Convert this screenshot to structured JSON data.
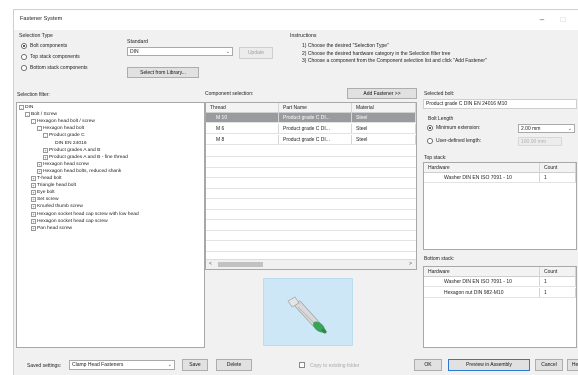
{
  "window": {
    "title": "Fastener System"
  },
  "selection_type": {
    "label": "Selection Type",
    "options": [
      "Bolt components",
      "Top stack components",
      "Bottom stack components"
    ],
    "selected": 0
  },
  "standard": {
    "label": "Standard",
    "value": "DIN",
    "update_label": "Update",
    "library_label": "Select from Library..."
  },
  "instructions": {
    "label": "Instructions",
    "lines": [
      "1) Choose the desired \"Selection Type\"",
      "2) Choose the desired hardware category in the Selection filter tree",
      "3) Choose a component from the Component selection list and click \"Add Fastener\""
    ]
  },
  "selection_filter": {
    "label": "Selection filter:",
    "items": [
      {
        "text": "DIN",
        "level": 0,
        "expander": "-"
      },
      {
        "text": "Bolt / Screw",
        "level": 1,
        "expander": "-"
      },
      {
        "text": "Hexagon head bolt / screw",
        "level": 2,
        "expander": "-"
      },
      {
        "text": "Hexagon head bolt",
        "level": 3,
        "expander": "-"
      },
      {
        "text": "Product grade C",
        "level": 4,
        "expander": "-"
      },
      {
        "text": "DIN EN 24016",
        "level": 6,
        "expander": ""
      },
      {
        "text": "Product grades A and B",
        "level": 4,
        "expander": "+"
      },
      {
        "text": "Product grades A and B - fine thread",
        "level": 4,
        "expander": "+"
      },
      {
        "text": "Hexagon head screw",
        "level": 3,
        "expander": "+"
      },
      {
        "text": "Hexagon head bolts, reduced shank",
        "level": 3,
        "expander": "+"
      },
      {
        "text": "T-head bolt",
        "level": 2,
        "expander": "+"
      },
      {
        "text": "Triangle head bolt",
        "level": 2,
        "expander": "+"
      },
      {
        "text": "Eye bolt",
        "level": 2,
        "expander": "+"
      },
      {
        "text": "Set screw",
        "level": 2,
        "expander": "+"
      },
      {
        "text": "Knurled thumb screw",
        "level": 2,
        "expander": "+"
      },
      {
        "text": "Hexagon socket head cap screw with low head",
        "level": 2,
        "expander": "+"
      },
      {
        "text": "Hexagon socket head cap screw",
        "level": 2,
        "expander": "+"
      },
      {
        "text": "Pan head screw",
        "level": 2,
        "expander": "+"
      }
    ]
  },
  "component_selection": {
    "label": "Component selection:",
    "add_label": "Add Fastener >>",
    "columns": [
      "Thread",
      "Part Name",
      "Material"
    ],
    "rows": [
      [
        "M 10",
        "Product grade C DI...",
        "Steel"
      ],
      [
        "M 6",
        "Product grade C DI...",
        "Steel"
      ],
      [
        "M 8",
        "Product grade C DI...",
        "Steel"
      ]
    ],
    "selected_row": 0
  },
  "selected_bolt": {
    "label": "Selected bolt:",
    "value": "Product grade C DIN EN 24016 M10",
    "bolt_length_label": "Bolt Length",
    "minimum_extension_label": "Minimum extension:",
    "minimum_extension_value": "2.00 mm",
    "user_defined_label": "User-defined length:",
    "user_defined_value": "100.00 mm"
  },
  "top_stack": {
    "label": "Top stack:",
    "columns": [
      "Hardware",
      "Count"
    ],
    "rows": [
      [
        "Washer DIN EN ISO 7091 - 10",
        "1"
      ]
    ]
  },
  "bottom_stack": {
    "label": "Bottom stack:",
    "columns": [
      "Hardware",
      "Count"
    ],
    "rows": [
      [
        "Washer DIN EN ISO 7091 - 10",
        "1"
      ],
      [
        "Hexagon nut DIN 982-M10",
        "1"
      ]
    ]
  },
  "footer": {
    "saved_settings_label": "Saved settings:",
    "saved_settings_value": "Clamp Head Fasteners",
    "save_label": "Save",
    "delete_label": "Delete",
    "copy_label": "Copy to existing folder",
    "ok_label": "OK",
    "preview_label": "Preview in Assembly",
    "cancel_label": "Cancel",
    "help_label": "Help"
  },
  "colors": {
    "selected_row": "#999b9e",
    "preview_bg": "#cde7f6",
    "bolt_green": "#3aa35a"
  }
}
